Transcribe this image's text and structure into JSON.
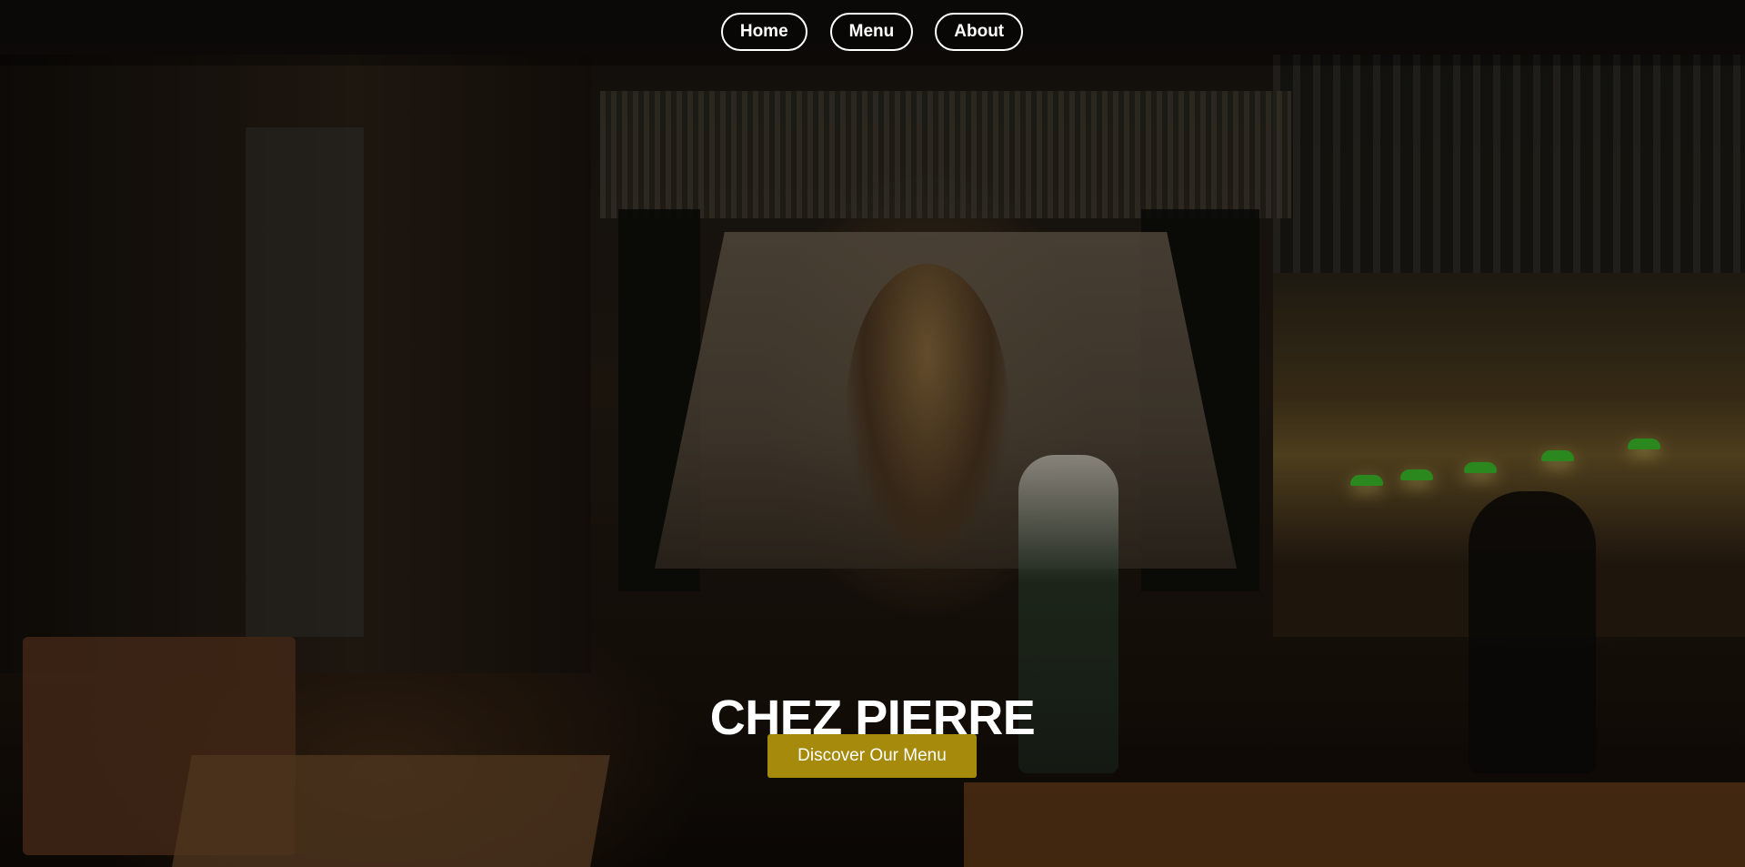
{
  "nav": {
    "items": [
      {
        "label": "Home"
      },
      {
        "label": "Menu"
      },
      {
        "label": "About"
      }
    ]
  },
  "hero": {
    "title": "CHEZ PIERRE",
    "cta_label": "Discover Our Menu"
  },
  "colors": {
    "accent": "#a68a0c",
    "text": "#ffffff"
  }
}
